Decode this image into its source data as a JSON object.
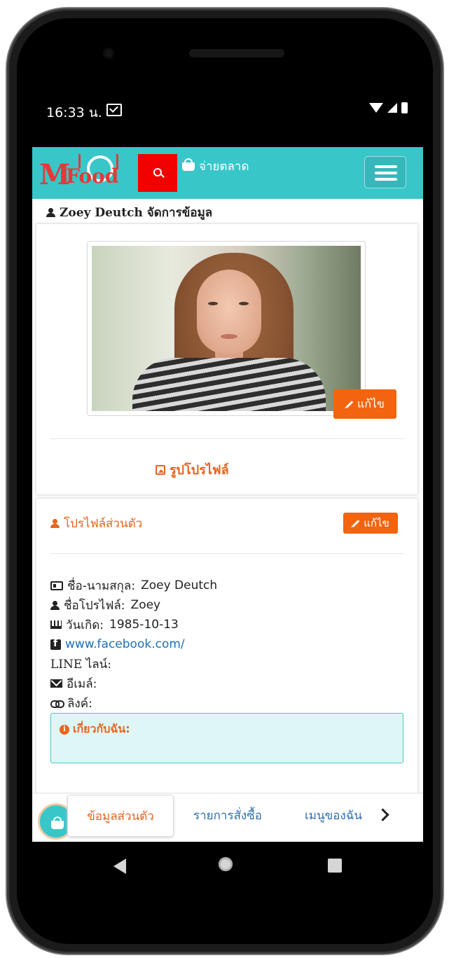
{
  "status_bar": {
    "time": "16:33 น."
  },
  "navbar": {
    "logo_m": "M",
    "logo_food": "Food",
    "market_label": "จ่ายตลาด"
  },
  "page": {
    "title": "Zoey Deutch จัดการข้อมูล"
  },
  "photo_card": {
    "label": "รูปโปรไฟล์",
    "edit_label": "แก้ไข"
  },
  "profile_card": {
    "title": "โปรไฟล์ส่วนตัว",
    "edit_label": "แก้ไข",
    "rows": [
      {
        "icon": "id-card-icon",
        "label": "ชื่อ-นามสกุล:",
        "value": "Zoey Deutch"
      },
      {
        "icon": "user-icon",
        "label": "ชื่อโปรไฟล์:",
        "value": "Zoey"
      },
      {
        "icon": "birthday-cake-icon",
        "label": "วันเกิด:",
        "value": "1985-10-13"
      },
      {
        "icon": "facebook-icon",
        "label": "",
        "value": "www.facebook.com/"
      },
      {
        "icon": "",
        "label": "LINE ไลน์:",
        "value": ""
      },
      {
        "icon": "envelope-icon",
        "label": "อีเมล์:",
        "value": ""
      },
      {
        "icon": "link-icon",
        "label": "ลิงค์:",
        "value": ""
      }
    ],
    "about_title": "เกี่ยวกับฉัน:"
  },
  "bottom_nav": {
    "tabs": [
      {
        "label": "ข้อมูลส่วนตัว",
        "active": true
      },
      {
        "label": "รายการสั่งซื้อ",
        "active": false
      },
      {
        "label": "เมนูของฉัน",
        "active": false
      }
    ]
  },
  "colors": {
    "brand_teal": "#38c6c9",
    "accent_orange": "#f2640f",
    "search_red": "#f20000",
    "link_blue": "#1e6fb5"
  }
}
